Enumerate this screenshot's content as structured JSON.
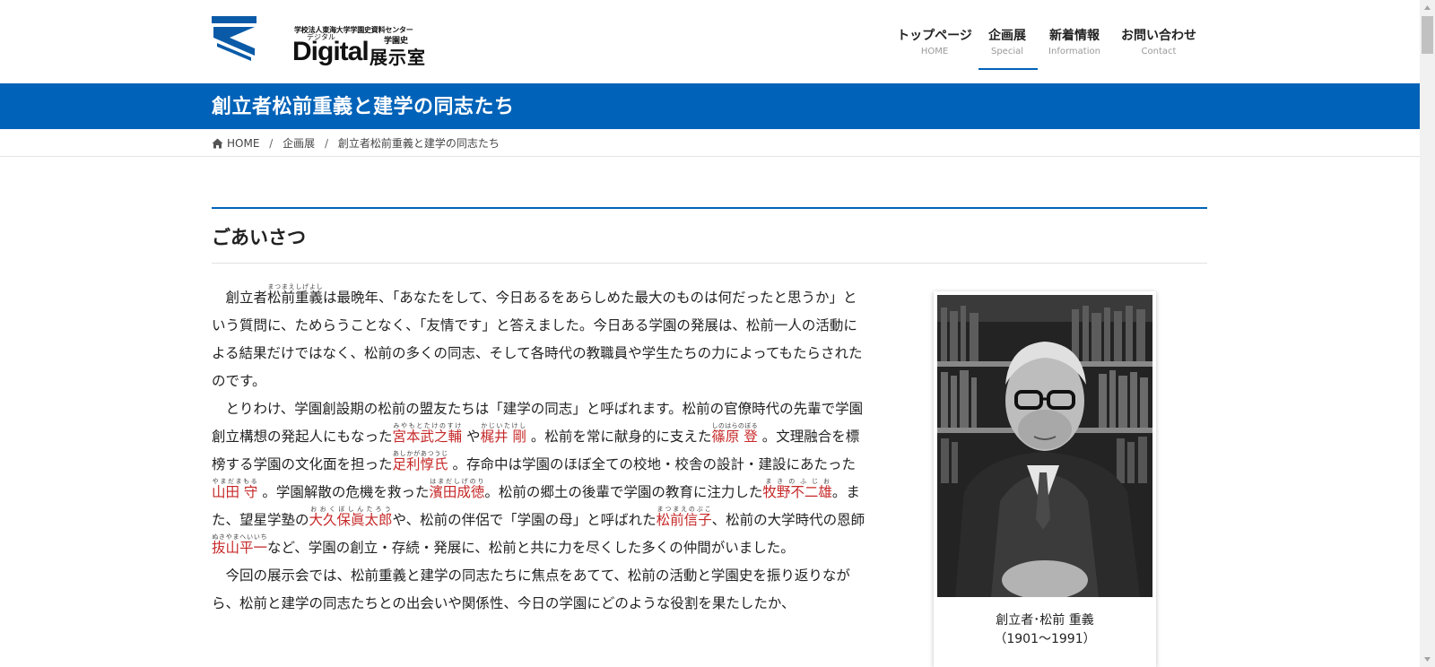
{
  "logo": {
    "org_line": "学校法人東海大学学園史資料センター",
    "digital": "Digital",
    "digital_ruby": "デジタル",
    "gakuenshi": "学園史",
    "tenjishitsu": "展示室"
  },
  "nav": {
    "items": [
      {
        "label": "トップページ",
        "sub": "HOME"
      },
      {
        "label": "企画展",
        "sub": "Special"
      },
      {
        "label": "新着情報",
        "sub": "Information"
      },
      {
        "label": "お問い合わせ",
        "sub": "Contact"
      }
    ],
    "active_index": 1
  },
  "page_title": "創立者松前重義と建学の同志たち",
  "breadcrumb": {
    "home": "HOME",
    "sep": "/",
    "level1": "企画展",
    "current": "創立者松前重義と建学の同志たち"
  },
  "section": {
    "heading": "ごあいさつ"
  },
  "article": {
    "p1": {
      "pre": "創立者",
      "name": "松前重義",
      "name_ruby": "まつまえしげよし",
      "post": "は最晩年、「あなたをして、今日あるをあらしめた最大のものは何だったと思うか」という質問に、ためらうことなく、「友情です」と答えました。今日ある学園の発展は、松前一人の活動による結果だけではなく、松前の多くの同志、そして各時代の教職員や学生たちの力によってもたらされたのです。"
    },
    "p2": {
      "t1": "とりわけ、学園創設期の松前の盟友たちは「建学の同志」と呼ばれます。松前の官僚時代の先輩で学園創立構想の発起人にもなった",
      "n1": "宮本武之輔",
      "r1": "みやもとたけのすけ",
      "t2": " や",
      "n2": "梶井 剛",
      "r2": "かじいたけし",
      "t3": " 。松前を常に献身的に支えた",
      "n3": "篠原 登",
      "r3": "しのはらのぼる",
      "t4": " 。文理融合を標榜する学園の文化面を担った",
      "n4": "足利惇氏",
      "r4": "あしかがあつうじ",
      "t5": " 。存命中は学園のほぼ全ての校地・校舎の設計・建設にあたった ",
      "n5": "山田 守",
      "r5": "やまだまもる",
      "t6": " 。学園解散の危機を救った",
      "n6": "濱田成徳",
      "r6": "はまだしげのり",
      "t7": "。松前の郷土の後輩で学園の教育に注力した",
      "n7": "牧野不二雄",
      "r7": "まきのふじお",
      "t8": "。また、望星学塾の",
      "n8": "大久保眞太郎",
      "r8": "おおくぼしんたろう",
      "t9": "や、松前の伴侶で「学園の母」と呼ばれた",
      "n9": "松前信子",
      "r9": "まつまえのぶこ",
      "t10": "、松前の大学時代の恩師",
      "n10": "抜山平一",
      "r10": "ぬきやまへいいち",
      "t11": "など、学園の創立・存続・発展に、松前と共に力を尽くした多くの仲間がいました。"
    },
    "p3": "今回の展示会では、松前重義と建学の同志たちに焦点をあてて、松前の活動と学園史を振り返りながら、松前と建学の同志たちとの出会いや関係性、今日の学園にどのような役割を果たしたか、"
  },
  "photo": {
    "caption_line1": "創立者･松前 重義",
    "caption_line2": "（1901～1991）"
  },
  "colors": {
    "brand_blue": "#0062b8",
    "name_red": "#c62828"
  }
}
